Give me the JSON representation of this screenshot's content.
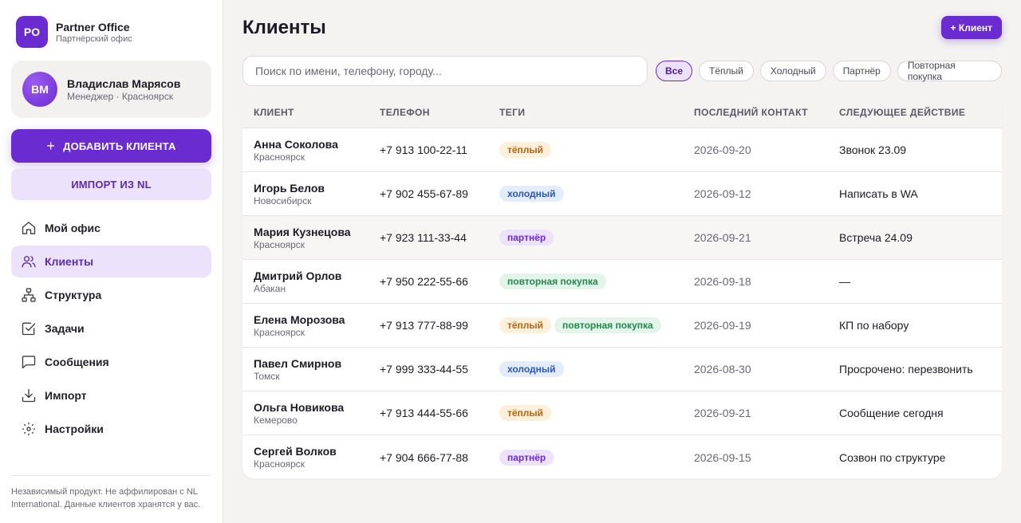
{
  "brand": {
    "logo": "PO",
    "name": "Partner Office",
    "subtitle": "Партнёрский офис"
  },
  "user": {
    "initials": "ВМ",
    "name": "Владислав Марясов",
    "role": "Менеджер · Красноярск"
  },
  "sidebar": {
    "add_client_label": "ДОБАВИТЬ КЛИЕНТА",
    "import_label": "ИМПОРТ ИЗ NL",
    "nav": [
      {
        "label": "Мой офис",
        "icon": "home-icon"
      },
      {
        "label": "Клиенты",
        "icon": "users-icon",
        "active": true
      },
      {
        "label": "Структура",
        "icon": "structure-icon"
      },
      {
        "label": "Задачи",
        "icon": "checkbox-icon"
      },
      {
        "label": "Сообщения",
        "icon": "message-icon"
      },
      {
        "label": "Импорт",
        "icon": "download-icon"
      },
      {
        "label": "Настройки",
        "icon": "gear-icon"
      }
    ],
    "disclaimer": "Независимый продукт. Не аффилирован с NL International. Данные клиентов хранятся у вас."
  },
  "main": {
    "title": "Клиенты",
    "add_button": "+ Клиент",
    "search_placeholder": "Поиск по имени, телефону, городу...",
    "filters": [
      "Все",
      "Тёплый",
      "Холодный",
      "Партнёр",
      "Повторная покупка"
    ],
    "active_filter": "Все",
    "columns": [
      "КЛИЕНТ",
      "ТЕЛЕФОН",
      "ТЕГИ",
      "ПОСЛЕДНИЙ КОНТАКТ",
      "СЛЕДУЮЩЕЕ ДЕЙСТВИЕ"
    ],
    "rows": [
      {
        "name": "Анна Соколова",
        "city": "Красноярск",
        "phone": "+7 913 100-22-11",
        "tags": [
          {
            "label": "тёплый",
            "kind": "warm"
          }
        ],
        "last_contact": "2026-09-20",
        "next_action": "Звонок 23.09"
      },
      {
        "name": "Игорь Белов",
        "city": "Новосибирск",
        "phone": "+7 902 455-67-89",
        "tags": [
          {
            "label": "холодный",
            "kind": "cold"
          }
        ],
        "last_contact": "2026-09-12",
        "next_action": "Написать в WA"
      },
      {
        "name": "Мария Кузнецова",
        "city": "Красноярск",
        "phone": "+7 923 111-33-44",
        "tags": [
          {
            "label": "партнёр",
            "kind": "partner"
          }
        ],
        "last_contact": "2026-09-21",
        "next_action": "Встреча 24.09",
        "highlighted": true
      },
      {
        "name": "Дмитрий Орлов",
        "city": "Абакан",
        "phone": "+7 950 222-55-66",
        "tags": [
          {
            "label": "повторная покупка",
            "kind": "repeat"
          }
        ],
        "last_contact": "2026-09-18",
        "next_action": "—"
      },
      {
        "name": "Елена Морозова",
        "city": "Красноярск",
        "phone": "+7 913 777-88-99",
        "tags": [
          {
            "label": "тёплый",
            "kind": "warm"
          },
          {
            "label": "повторная покупка",
            "kind": "repeat"
          }
        ],
        "last_contact": "2026-09-19",
        "next_action": "КП по набору"
      },
      {
        "name": "Павел Смирнов",
        "city": "Томск",
        "phone": "+7 999 333-44-55",
        "tags": [
          {
            "label": "холодный",
            "kind": "cold"
          }
        ],
        "last_contact": "2026-08-30",
        "next_action": "Просрочено: перезвонить"
      },
      {
        "name": "Ольга Новикова",
        "city": "Кемерово",
        "phone": "+7 913 444-55-66",
        "tags": [
          {
            "label": "тёплый",
            "kind": "warm"
          }
        ],
        "last_contact": "2026-09-21",
        "next_action": "Сообщение сегодня"
      },
      {
        "name": "Сергей Волков",
        "city": "Красноярск",
        "phone": "+7 904 666-77-88",
        "tags": [
          {
            "label": "партнёр",
            "kind": "partner"
          }
        ],
        "last_contact": "2026-09-15",
        "next_action": "Созвон по структуре"
      }
    ]
  },
  "colors": {
    "accent": "#6a2bd1",
    "accent_soft": "#ece2fb",
    "background": "#f4f3f1"
  }
}
